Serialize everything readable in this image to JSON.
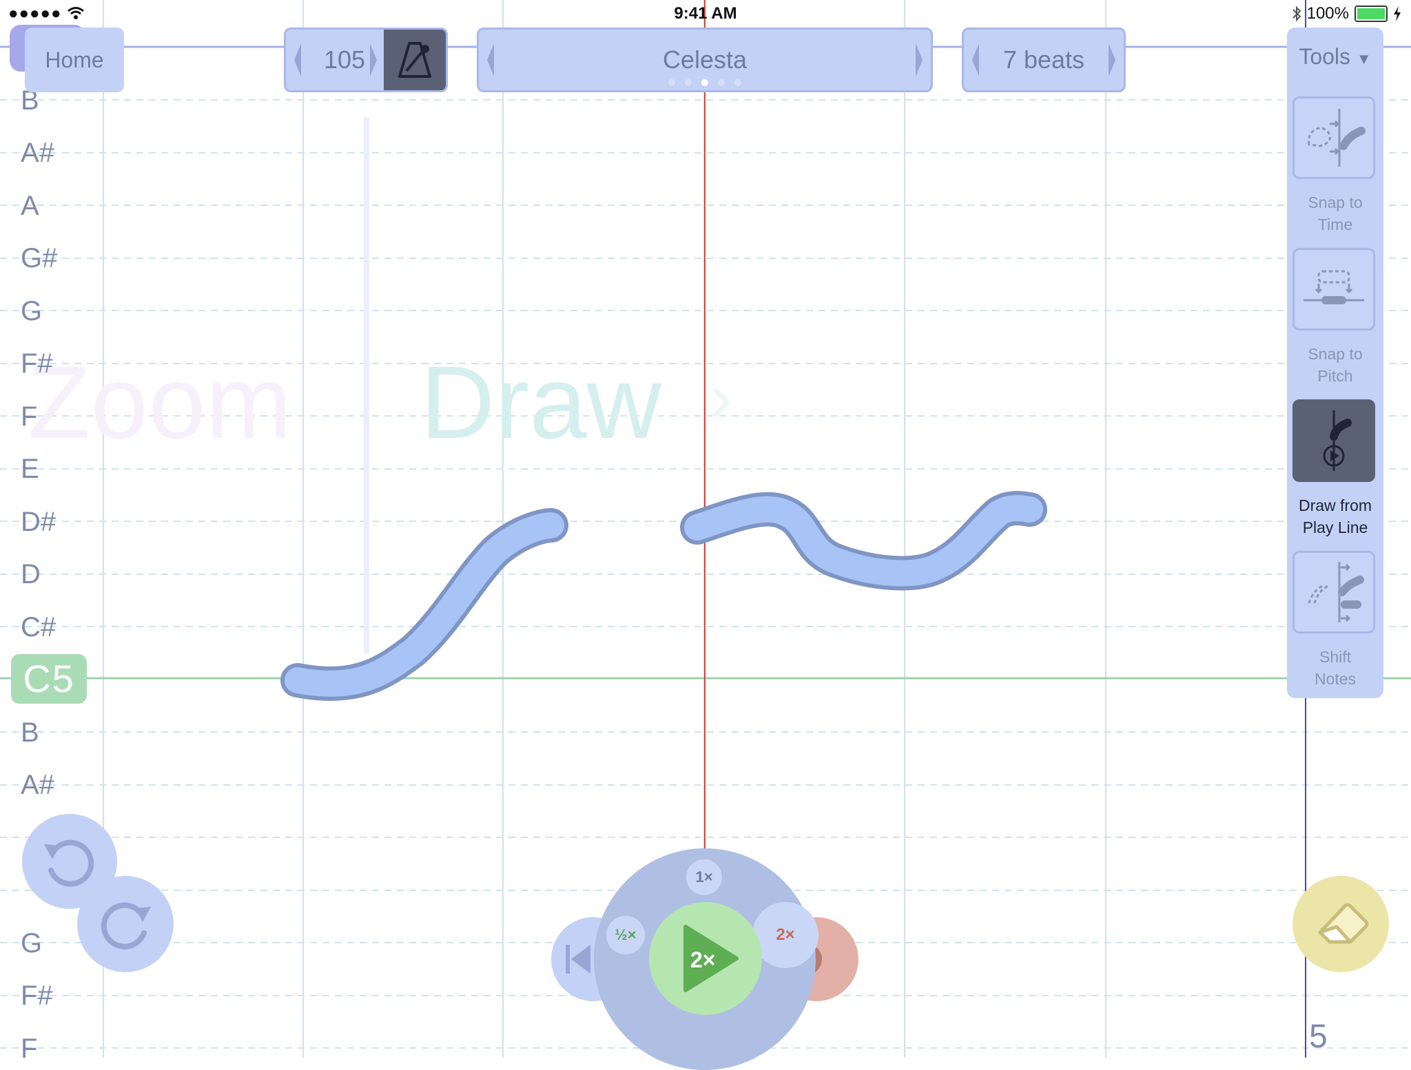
{
  "status_bar": {
    "time": "9:41 AM",
    "signal": "●●●●●",
    "battery_percent": "100%",
    "battery_color": "#4cd964"
  },
  "toolbar": {
    "home_label": "Home",
    "tempo": "105",
    "instrument": "Celesta",
    "instrument_page": 3,
    "instrument_pages": 5,
    "beats": "7 beats"
  },
  "tools": {
    "title": "Tools",
    "items": [
      {
        "label_line1": "Snap to",
        "label_line2": "Time",
        "active": false,
        "icon": "snap-time-icon"
      },
      {
        "label_line1": "Snap to",
        "label_line2": "Pitch",
        "active": false,
        "icon": "snap-pitch-icon"
      },
      {
        "label_line1": "Draw from",
        "label_line2": "Play Line",
        "active": true,
        "icon": "draw-playline-icon"
      },
      {
        "label_line1": "Shift",
        "label_line2": "Notes",
        "active": false,
        "icon": "shift-notes-icon"
      }
    ]
  },
  "pitch_labels": {
    "b_upper": "B",
    "a_sharp_upper": "A#",
    "a_upper": "A",
    "g_sharp_upper": "G#",
    "g_upper": "G",
    "f_sharp_upper": "F#",
    "f_upper": "F",
    "e_upper": "E",
    "d_sharp_upper": "D#",
    "d_upper": "D",
    "c_sharp_upper": "C#",
    "c5": "C5",
    "b_lower": "B",
    "a_sharp_lower": "A#",
    "g_lower": "G",
    "f_sharp_lower": "F#",
    "f_lower": "F"
  },
  "modes": {
    "zoom": "Zoom",
    "draw": "Draw"
  },
  "transport": {
    "speed_1x": "1×",
    "speed_half": "½×",
    "speed_2x": "2×",
    "play_label": "2×"
  },
  "page_number": "5",
  "colors": {
    "panel": "#c3d1f6",
    "panel_border": "#a9b8e6",
    "active_tool": "#5a6175",
    "stroke_fill": "#a8c3f5",
    "stroke_outline": "#7f95c4",
    "play_line": "#d8443c",
    "c5_highlight": "#a9dcb5",
    "play_button": "#b5e6b0",
    "record_button": "#e2b0a6",
    "eraser_button": "#ece5a8"
  }
}
